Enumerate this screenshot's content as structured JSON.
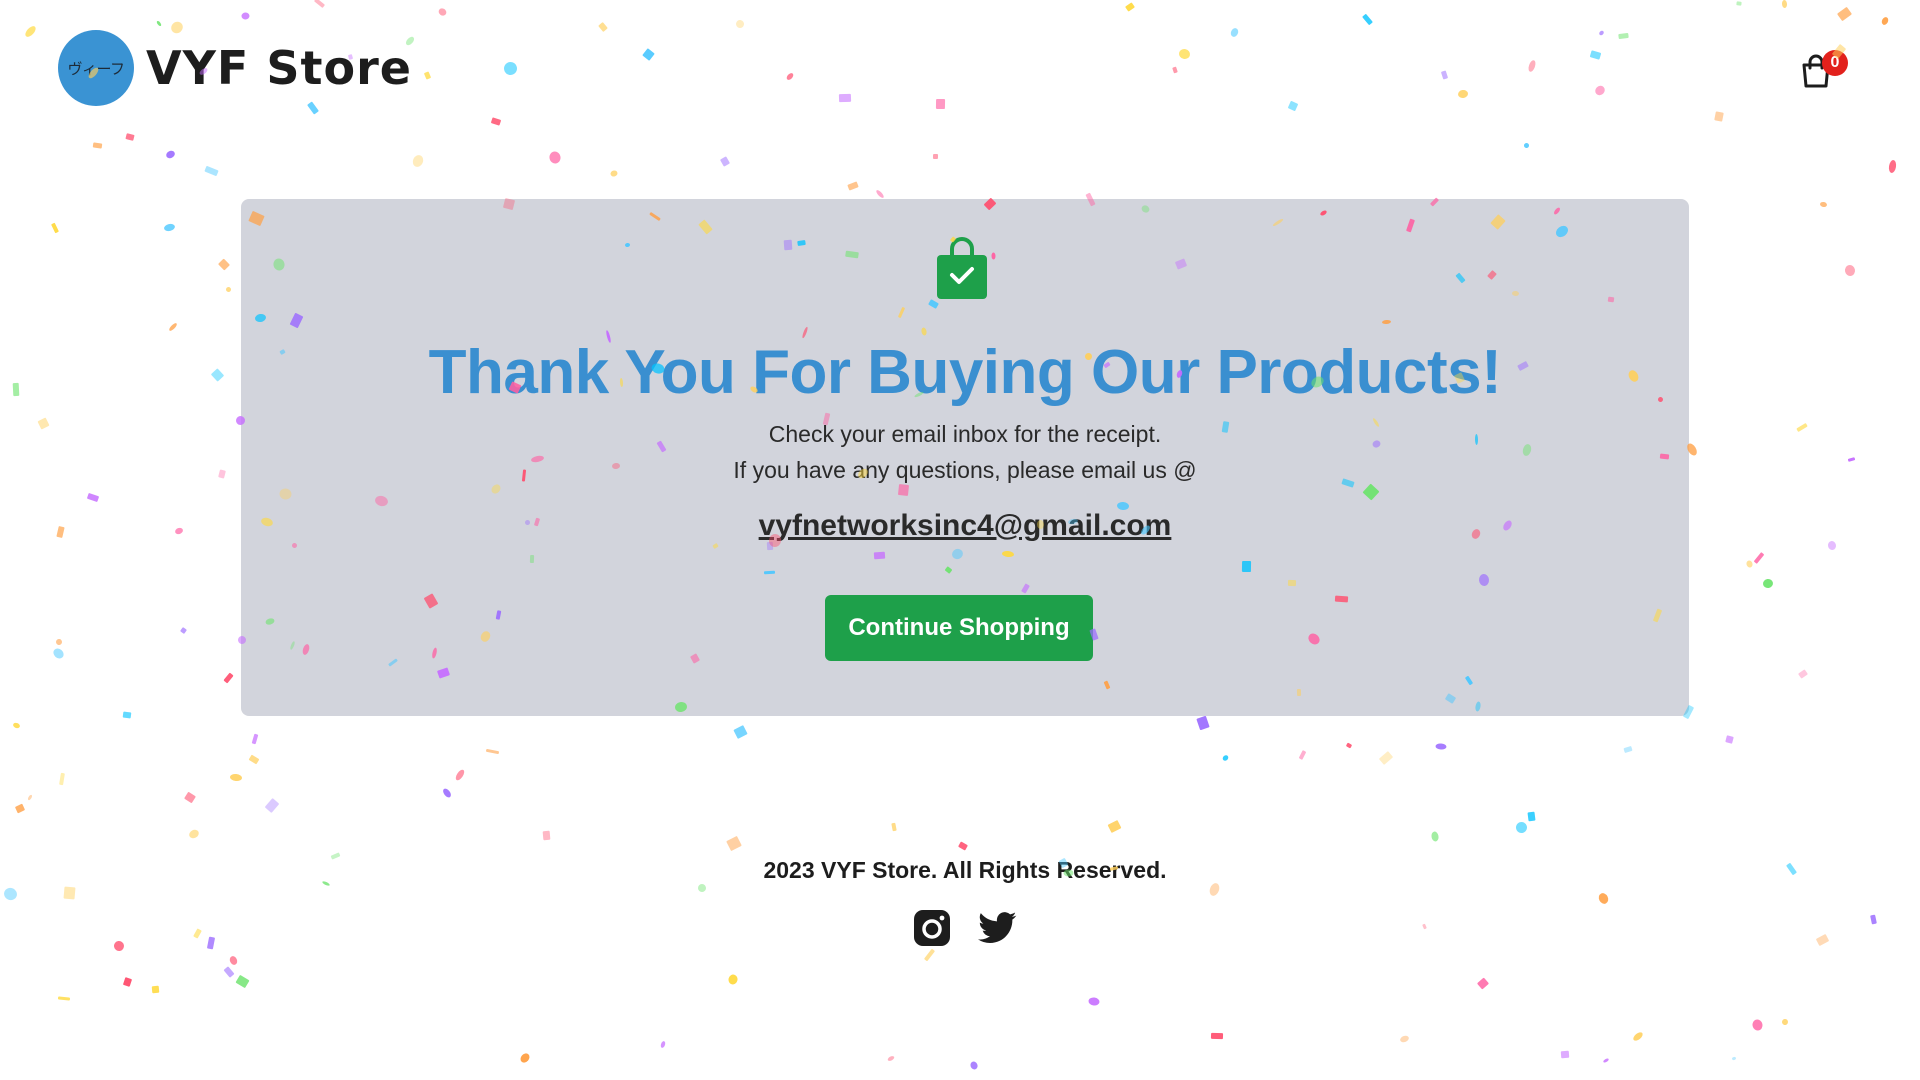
{
  "header": {
    "logo_text": "ヴィーフ",
    "brand_name": "VYF Store",
    "cart_count": "0"
  },
  "success": {
    "title": "Thank You For Buying Our Products!",
    "line1": "Check your email inbox for the receipt.",
    "line2": "If you have any questions, please email us @",
    "email": "vyfnetworksinc4@gmail.com",
    "button_label": "Continue Shopping"
  },
  "footer": {
    "copyright": "2023 VYF Store. All Rights Reserved.",
    "socials": [
      "instagram-icon",
      "twitter-icon"
    ]
  },
  "colors": {
    "brand_blue": "#3a8fd0",
    "card_bg": "#d2d4dc",
    "button_green": "#1ea04a",
    "badge_red": "#e2211c"
  }
}
